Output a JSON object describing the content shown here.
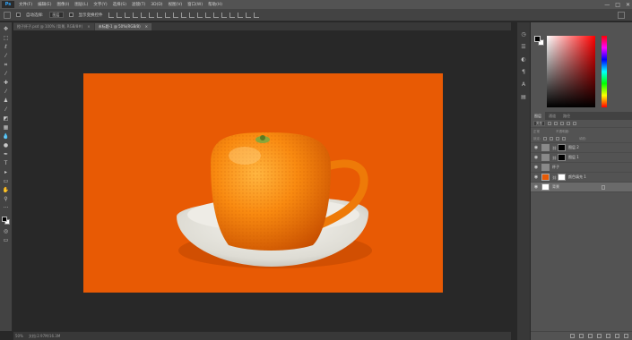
{
  "app": {
    "logo": "Ps"
  },
  "menu": [
    "文件(F)",
    "编辑(E)",
    "图像(I)",
    "图层(L)",
    "文字(Y)",
    "选择(S)",
    "滤镜(T)",
    "3D(D)",
    "视图(V)",
    "窗口(W)",
    "帮助(H)"
  ],
  "window_controls": {
    "minimize": "—",
    "maximize": "□",
    "close": "✕"
  },
  "options": {
    "auto_select_label": "自动选择:",
    "auto_select_value": "图层",
    "show_transform_label": "显示变换控件"
  },
  "tabs": [
    {
      "label": "橙子杯子.psd @ 100% (背景, RGB/8#)",
      "close": "×"
    },
    {
      "label": "未标题-1 @ 50%(RGB/8)",
      "close": "×"
    }
  ],
  "status": {
    "zoom": "50%",
    "doc": "文档:2.97M/16.3M"
  },
  "panels": {
    "layers_tab": "图层",
    "channels_tab": "通道",
    "paths_tab": "路径",
    "filter_kind": "类型",
    "blend_mode": "正常",
    "opacity_label": "不透明度:",
    "lock_label": "锁定:",
    "fill_label": "填充:"
  },
  "layers": [
    {
      "name": "图层 2",
      "thumb": "cup",
      "mask": true
    },
    {
      "name": "图层 1",
      "thumb": "cup",
      "mask": true
    },
    {
      "name": "杯子",
      "thumb": "cup",
      "mask": false
    },
    {
      "name": "颜色填充 1",
      "thumb": "orange",
      "mask": true
    },
    {
      "name": "背景",
      "thumb": "white",
      "mask": false,
      "locked": true
    }
  ],
  "colors": {
    "canvas_background": "#e85a04",
    "accent": "#31a8ff"
  }
}
